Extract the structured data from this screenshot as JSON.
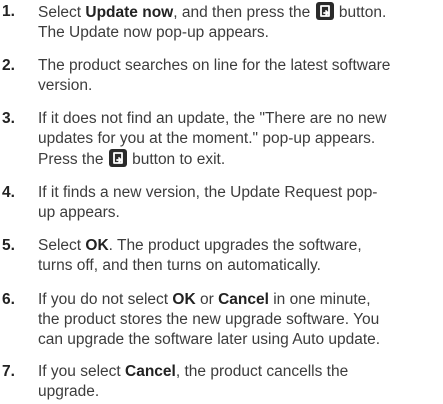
{
  "steps": [
    {
      "number": "1.",
      "parts": [
        {
          "t": "Select "
        },
        {
          "t": "Update now",
          "b": true
        },
        {
          "t": ", and then press the "
        },
        {
          "icon": "enter-icon"
        },
        {
          "t": " button."
        },
        {
          "br": true
        },
        {
          "t": "The Update now pop-up appears."
        }
      ]
    },
    {
      "number": "2.",
      "parts": [
        {
          "t": "The product searches on line for the latest software"
        },
        {
          "br": true
        },
        {
          "t": "version."
        }
      ]
    },
    {
      "number": "3.",
      "parts": [
        {
          "t": "If it does not find an update, the \"There are no new"
        },
        {
          "br": true
        },
        {
          "t": "updates for you at the moment.\" pop-up appears."
        },
        {
          "br": true
        },
        {
          "t": "Press the "
        },
        {
          "icon": "enter-icon"
        },
        {
          "t": " button to exit."
        }
      ]
    },
    {
      "number": "4.",
      "parts": [
        {
          "t": "If it finds a new version, the Update Request pop-"
        },
        {
          "br": true
        },
        {
          "t": "up appears."
        }
      ]
    },
    {
      "number": "5.",
      "parts": [
        {
          "t": "Select "
        },
        {
          "t": "OK",
          "b": true
        },
        {
          "t": ". The product upgrades the software,"
        },
        {
          "br": true
        },
        {
          "t": "turns off, and then turns on automatically."
        }
      ]
    },
    {
      "number": "6.",
      "parts": [
        {
          "t": "If you do not select "
        },
        {
          "t": "OK",
          "b": true
        },
        {
          "t": " or "
        },
        {
          "t": "Cancel",
          "b": true
        },
        {
          "t": " in one minute,"
        },
        {
          "br": true
        },
        {
          "t": "the product stores the new upgrade software. You"
        },
        {
          "br": true
        },
        {
          "t": "can upgrade the software later using Auto update."
        }
      ]
    },
    {
      "number": "7.",
      "parts": [
        {
          "t": "If you select "
        },
        {
          "t": "Cancel",
          "b": true
        },
        {
          "t": ", the product cancells the"
        },
        {
          "br": true
        },
        {
          "t": "upgrade."
        }
      ]
    }
  ]
}
